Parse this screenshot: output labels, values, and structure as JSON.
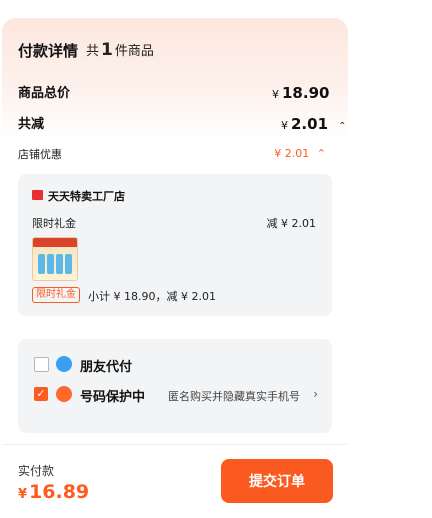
{
  "header": {
    "title": "付款详情",
    "count_prefix": "共",
    "count": "1",
    "count_suffix": "件商品"
  },
  "summary": {
    "total_label": "商品总价",
    "currency": "¥",
    "total_value": "18.90",
    "discount_label": "共减",
    "discount_value": "2.01",
    "shop_discount_label": "店铺优惠",
    "shop_discount_value": "¥ 2.01"
  },
  "store": {
    "name": "天天特卖工厂店",
    "gift_label": "限时礼金",
    "gift_amount": "减 ¥ 2.01",
    "tag": "限时礼金",
    "subtotal": "小计 ¥ 18.90，减 ¥ 2.01"
  },
  "options": {
    "friend_pay_label": "朋友代付",
    "friend_pay_checked": false,
    "number_protect_label": "号码保护中",
    "number_protect_checked": true,
    "number_protect_desc": "匿名购买并隐藏真实手机号"
  },
  "footer": {
    "pay_label": "实付款",
    "currency": "¥",
    "pay_value": "16.89",
    "submit_label": "提交订单"
  },
  "colors": {
    "accent": "#ff5a1f",
    "card_bg": "#f3f4f6"
  }
}
